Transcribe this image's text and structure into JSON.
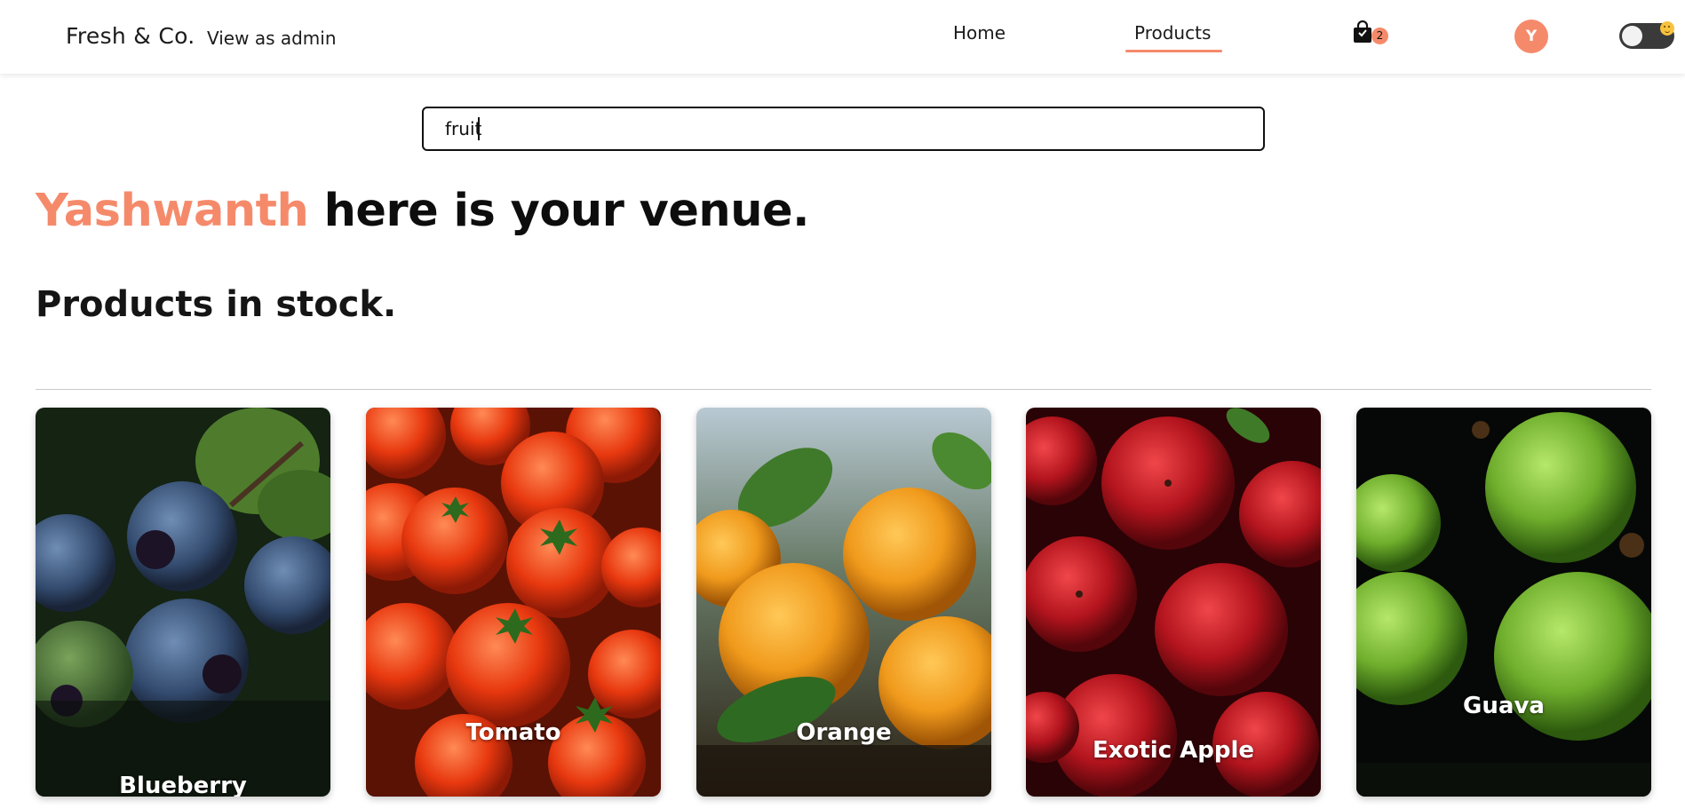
{
  "header": {
    "brand": "Fresh & Co.",
    "admin_link": "View as admin",
    "nav": {
      "home": "Home",
      "products": "Products",
      "active": "Products"
    },
    "cart": {
      "count": "2",
      "icon": "shopping-bag-icon"
    },
    "avatar_initial": "Y",
    "theme_toggle": {
      "state": "off",
      "icon": "sun-emoji-icon"
    }
  },
  "search": {
    "value": "fruit",
    "placeholder": ""
  },
  "hero": {
    "name": "Yashwanth",
    "rest": " here is your venue."
  },
  "section": {
    "title": "Products in stock."
  },
  "products": [
    {
      "name": "Blueberry",
      "image": "blueberry-photo"
    },
    {
      "name": "Tomato",
      "image": "tomato-photo"
    },
    {
      "name": "Orange",
      "image": "orange-photo"
    },
    {
      "name": "Exotic Apple",
      "image": "apple-photo"
    },
    {
      "name": "Guava",
      "image": "guava-photo"
    }
  ],
  "colors": {
    "accent": "#f58a6b",
    "text": "#111111",
    "toggle": "#3a3a3a"
  }
}
